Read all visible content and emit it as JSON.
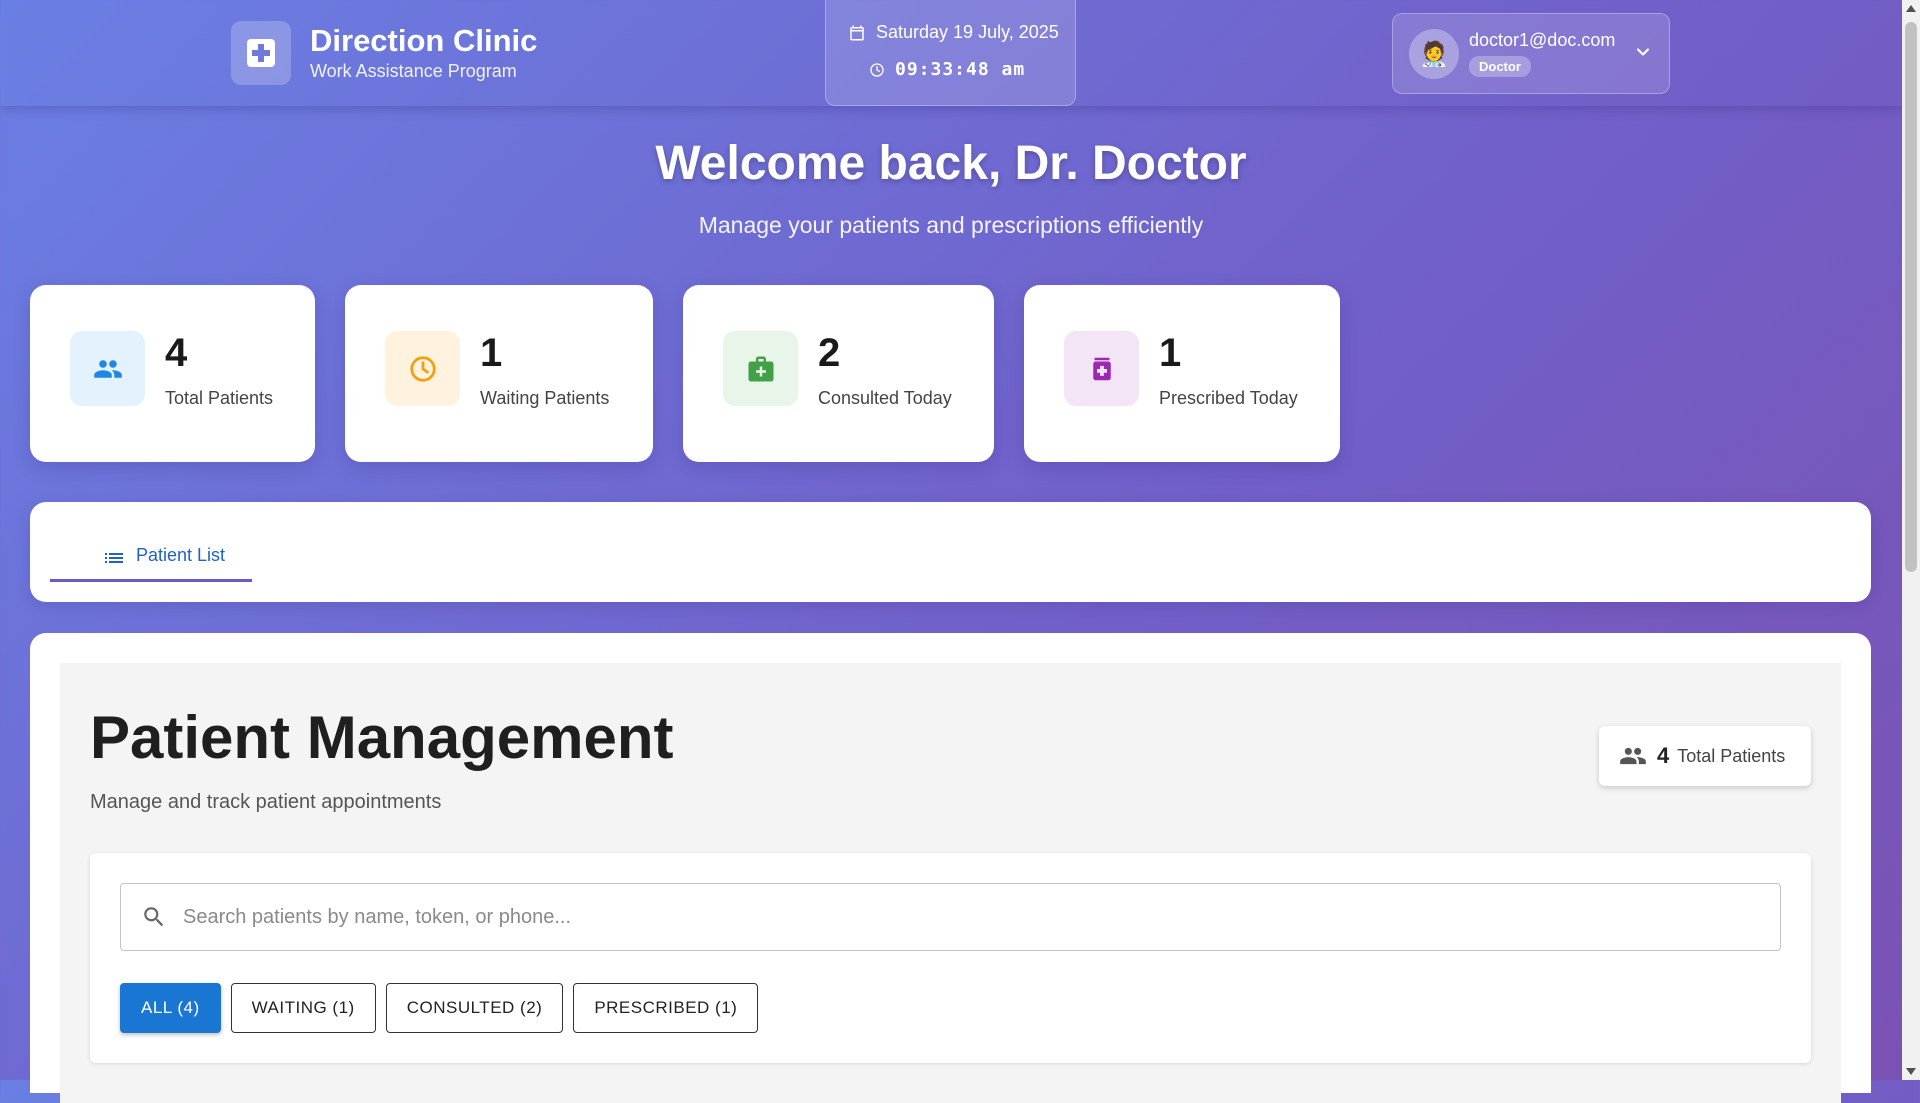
{
  "header": {
    "brand_title": "Direction Clinic",
    "brand_subtitle": "Work Assistance Program",
    "date": "Saturday 19 July, 2025",
    "time": "09:33:48 am",
    "user_email": "doctor1@doc.com",
    "user_role": "Doctor"
  },
  "welcome": {
    "title": "Welcome back, Dr. Doctor",
    "subtitle": "Manage your patients and prescriptions efficiently"
  },
  "stats": [
    {
      "value": "4",
      "label": "Total Patients",
      "icon": "group-icon",
      "color": "#1e88e5",
      "bg": "#e3f2fd"
    },
    {
      "value": "1",
      "label": "Waiting Patients",
      "icon": "clock-icon",
      "color": "#f59e0b",
      "bg": "#fff3e0"
    },
    {
      "value": "2",
      "label": "Consulted Today",
      "icon": "medical-bag-icon",
      "color": "#43a047",
      "bg": "#e8f5e9"
    },
    {
      "value": "1",
      "label": "Prescribed Today",
      "icon": "medication-icon",
      "color": "#9c27b0",
      "bg": "#f3e5f5"
    }
  ],
  "tabs": [
    {
      "label": "Patient List",
      "icon": "list-icon",
      "active": true
    }
  ],
  "patient_management": {
    "title": "Patient Management",
    "subtitle": "Manage and track patient appointments",
    "total_count": "4",
    "total_label": "Total Patients",
    "search_placeholder": "Search patients by name, token, or phone...",
    "filters": [
      {
        "label": "ALL (4)",
        "active": true
      },
      {
        "label": "WAITING (1)",
        "active": false
      },
      {
        "label": "CONSULTED (2)",
        "active": false
      },
      {
        "label": "PRESCRIBED (1)",
        "active": false
      }
    ]
  },
  "colors": {
    "accent": "#1976d2",
    "tab_text": "#1e62c7",
    "tab_indicator": "#7158c7"
  }
}
